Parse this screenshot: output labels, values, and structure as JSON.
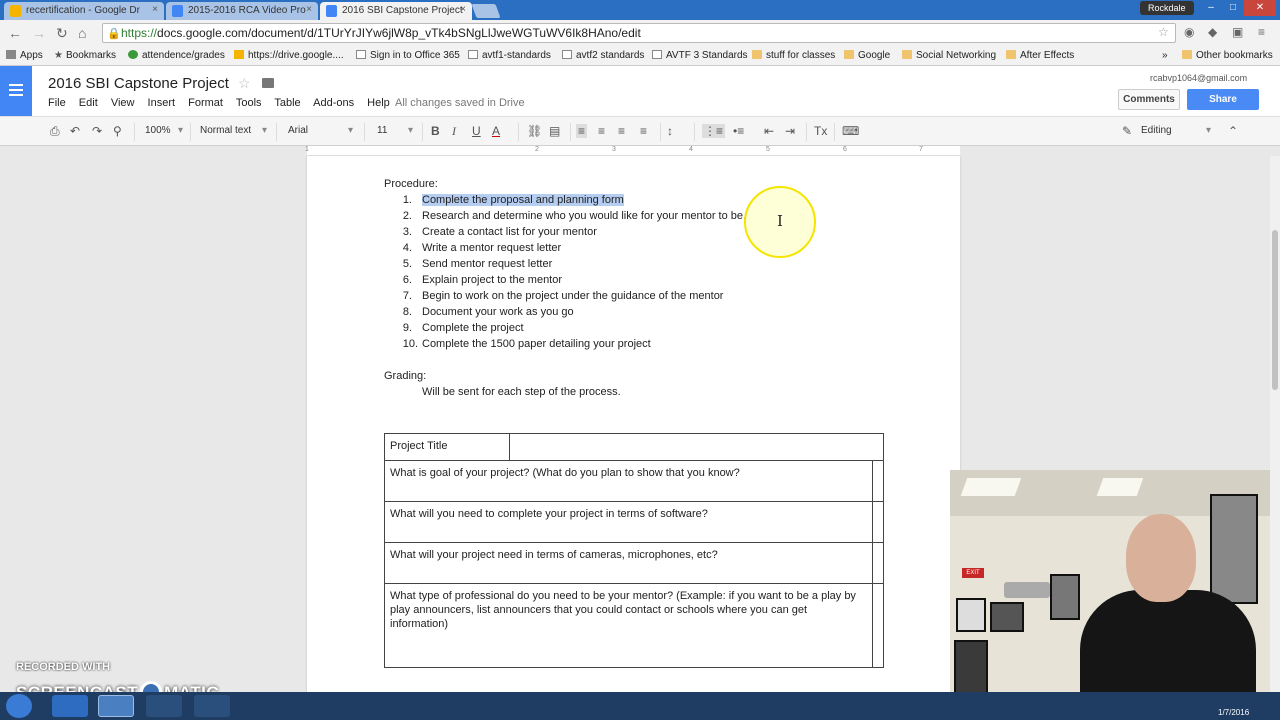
{
  "browser": {
    "tabs": [
      {
        "label": "recertification - Google Dr",
        "favicon_color": "#f4b400"
      },
      {
        "label": "2015-2016 RCA Video Pro",
        "favicon_color": "#4285f4"
      },
      {
        "label": "2016 SBI Capstone Project",
        "favicon_color": "#4285f4"
      }
    ],
    "profile_label": "Rockdale",
    "url_https": "https://",
    "url_rest": "docs.google.com/document/d/1TUrYrJIYw6jlW8p_vTk4bSNgLlJweWGTuWV6Ik8HAno/edit"
  },
  "bookmarks": {
    "apps": "Apps",
    "items": [
      {
        "label": "Bookmarks",
        "icon": "star-icon"
      },
      {
        "label": "attendence/grades",
        "icon": "page-icon"
      },
      {
        "label": "https://drive.google....",
        "icon": "drive-icon"
      },
      {
        "label": "Sign in to Office 365",
        "icon": "page-icon"
      },
      {
        "label": "avtf1-standards",
        "icon": "page-icon"
      },
      {
        "label": "avtf2 standards",
        "icon": "page-icon"
      },
      {
        "label": "AVTF 3 Standards",
        "icon": "page-icon"
      },
      {
        "label": "stuff for classes",
        "icon": "folder-icon"
      },
      {
        "label": "Google",
        "icon": "folder-icon"
      },
      {
        "label": "Social Networking",
        "icon": "folder-icon"
      },
      {
        "label": "After Effects",
        "icon": "folder-icon"
      }
    ],
    "more": "»",
    "other": "Other bookmarks"
  },
  "docs": {
    "title": "2016 SBI Capstone Project",
    "menu": [
      "File",
      "Edit",
      "View",
      "Insert",
      "Format",
      "Tools",
      "Table",
      "Add-ons",
      "Help"
    ],
    "save_status": "All changes saved in Drive",
    "account_email": "rcabvp1064@gmail.com",
    "comments_label": "Comments",
    "share_label": "Share"
  },
  "toolbar": {
    "zoom": "100%",
    "style": "Normal text",
    "font": "Arial",
    "size": "11",
    "mode": "Editing"
  },
  "ruler": [
    "1",
    "2",
    "3",
    "4",
    "5",
    "6",
    "7"
  ],
  "document": {
    "procedure_heading": "Procedure:",
    "steps": [
      "Complete the proposal and planning form",
      "Research and determine who you would like for your mentor to be.",
      "Create a contact list for your mentor",
      "Write a mentor request letter",
      "Send mentor request letter",
      "Explain project to the mentor",
      "Begin to work on the project under the guidance of the mentor",
      "Document your work as you go",
      "Complete the project",
      "Complete the 1500 paper detailing your project"
    ],
    "step_numbers": [
      "1.",
      "2.",
      "3.",
      "4.",
      "5.",
      "6.",
      "7.",
      "8.",
      "9.",
      "10."
    ],
    "grading_heading": "Grading:",
    "grading_text": "Will be sent for each step of the process.",
    "table": {
      "title_label": "Project Title",
      "questions": [
        "What is goal of your project? (What do you plan to show that you know?",
        "What will you need to complete your project in terms of software?",
        "What will your project need in terms of cameras, microphones, etc?",
        "What type of professional do you need to be your mentor? (Example: if you want to be a play by play announcers, list announcers that you could contact or schools where you can get information)"
      ]
    }
  },
  "watermark": {
    "line1": "RECORDED WITH",
    "line2_a": "SCREENCAST",
    "line2_b": "MATIC"
  },
  "clock": "1/7/2016",
  "webcam_sign": "EXIT"
}
